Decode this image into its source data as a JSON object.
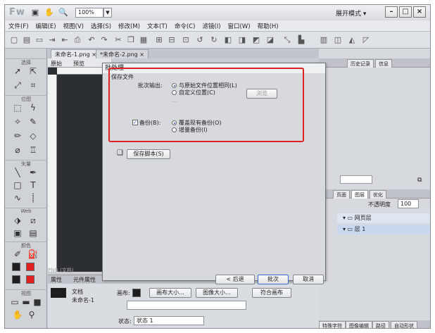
{
  "app": {
    "logo": "Fw",
    "zoom": "100%",
    "workspace": "展开模式 ▾",
    "min": "–",
    "max": "□",
    "close": "×"
  },
  "menu": [
    "文件(F)",
    "编辑(E)",
    "视图(V)",
    "选择(S)",
    "修改(M)",
    "文本(T)",
    "命令(C)",
    "滤镜(I)",
    "窗口(W)",
    "帮助(H)"
  ],
  "tools": {
    "sections": [
      "选择",
      "位图",
      "矢量",
      "Web",
      "颜色",
      "视图"
    ]
  },
  "doc": {
    "tabs": [
      "未命名-1.png ×",
      "*未命名-2.png ×"
    ],
    "view_original": "原始",
    "view_preview": "预览",
    "status": "PNG (文档)"
  },
  "panels": {
    "history_tabs": [
      "历史记录",
      "信息"
    ],
    "layers_tabs": [
      "页面",
      "图层",
      "优化"
    ],
    "opacity_label": "不透明度",
    "opacity_value": "100",
    "layers": [
      "网页层",
      "层 1"
    ],
    "bottom_tabs": [
      "特殊字符",
      "图像编辑",
      "路径",
      "自动形状"
    ]
  },
  "props": {
    "tabs": [
      "属性",
      "元件属性"
    ],
    "doc_label": "文档",
    "doc_name": "未命名-1",
    "canvas_label": "画布:",
    "canvas_size_btn": "画布大小...",
    "image_size_btn": "图像大小...",
    "fit_canvas_btn": "符合画布",
    "state_label": "状态:",
    "state_value": "状态 1"
  },
  "dialog": {
    "title": "批处理",
    "group": "保存文件",
    "output_label": "批次输出:",
    "output_opt1": "与原始文件位置相同(L)",
    "output_opt2": "自定义位置(C)",
    "browse": "浏览",
    "path_hint": "...",
    "backup_label": "备份(B):",
    "backup_opt1": "覆盖现有备份(O)",
    "backup_opt2": "增量备份(I)",
    "save_script": "保存脚本(S)",
    "back": "< 后退",
    "batch": "批次",
    "cancel": "取消"
  },
  "colors": {
    "highlight": "#e02020",
    "accent": "#1b4fc4",
    "swatch": "#1e1e1e",
    "fill": "#e02020"
  }
}
